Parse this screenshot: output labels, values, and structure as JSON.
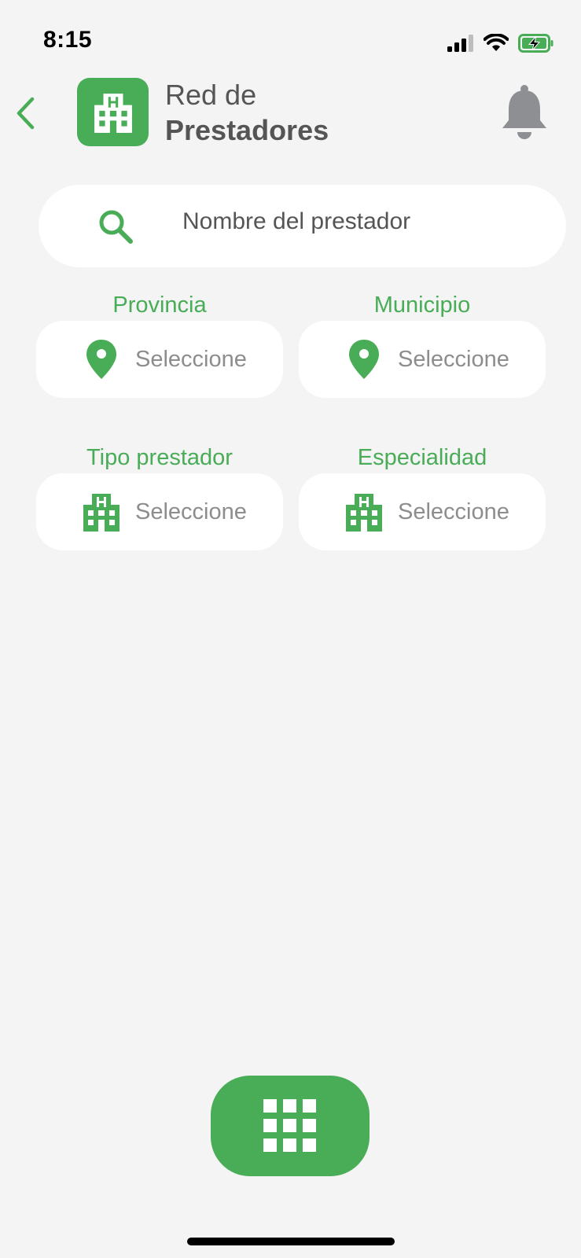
{
  "status_bar": {
    "time": "8:15"
  },
  "header": {
    "title_line1": "Red de",
    "title_line2": "Prestadores"
  },
  "search": {
    "placeholder": "Nombre del prestador"
  },
  "filters": [
    {
      "label": "Provincia",
      "value": "Seleccione",
      "icon": "location-pin-icon"
    },
    {
      "label": "Municipio",
      "value": "Seleccione",
      "icon": "location-pin-icon"
    },
    {
      "label": "Tipo prestador",
      "value": "Seleccione",
      "icon": "hospital-building-icon"
    },
    {
      "label": "Especialidad",
      "value": "Seleccione",
      "icon": "hospital-building-icon"
    }
  ],
  "colors": {
    "accent": "#49ac57",
    "background": "#f4f4f4",
    "placeholder_text": "#8d8d8d",
    "bell": "#8e8f93"
  }
}
